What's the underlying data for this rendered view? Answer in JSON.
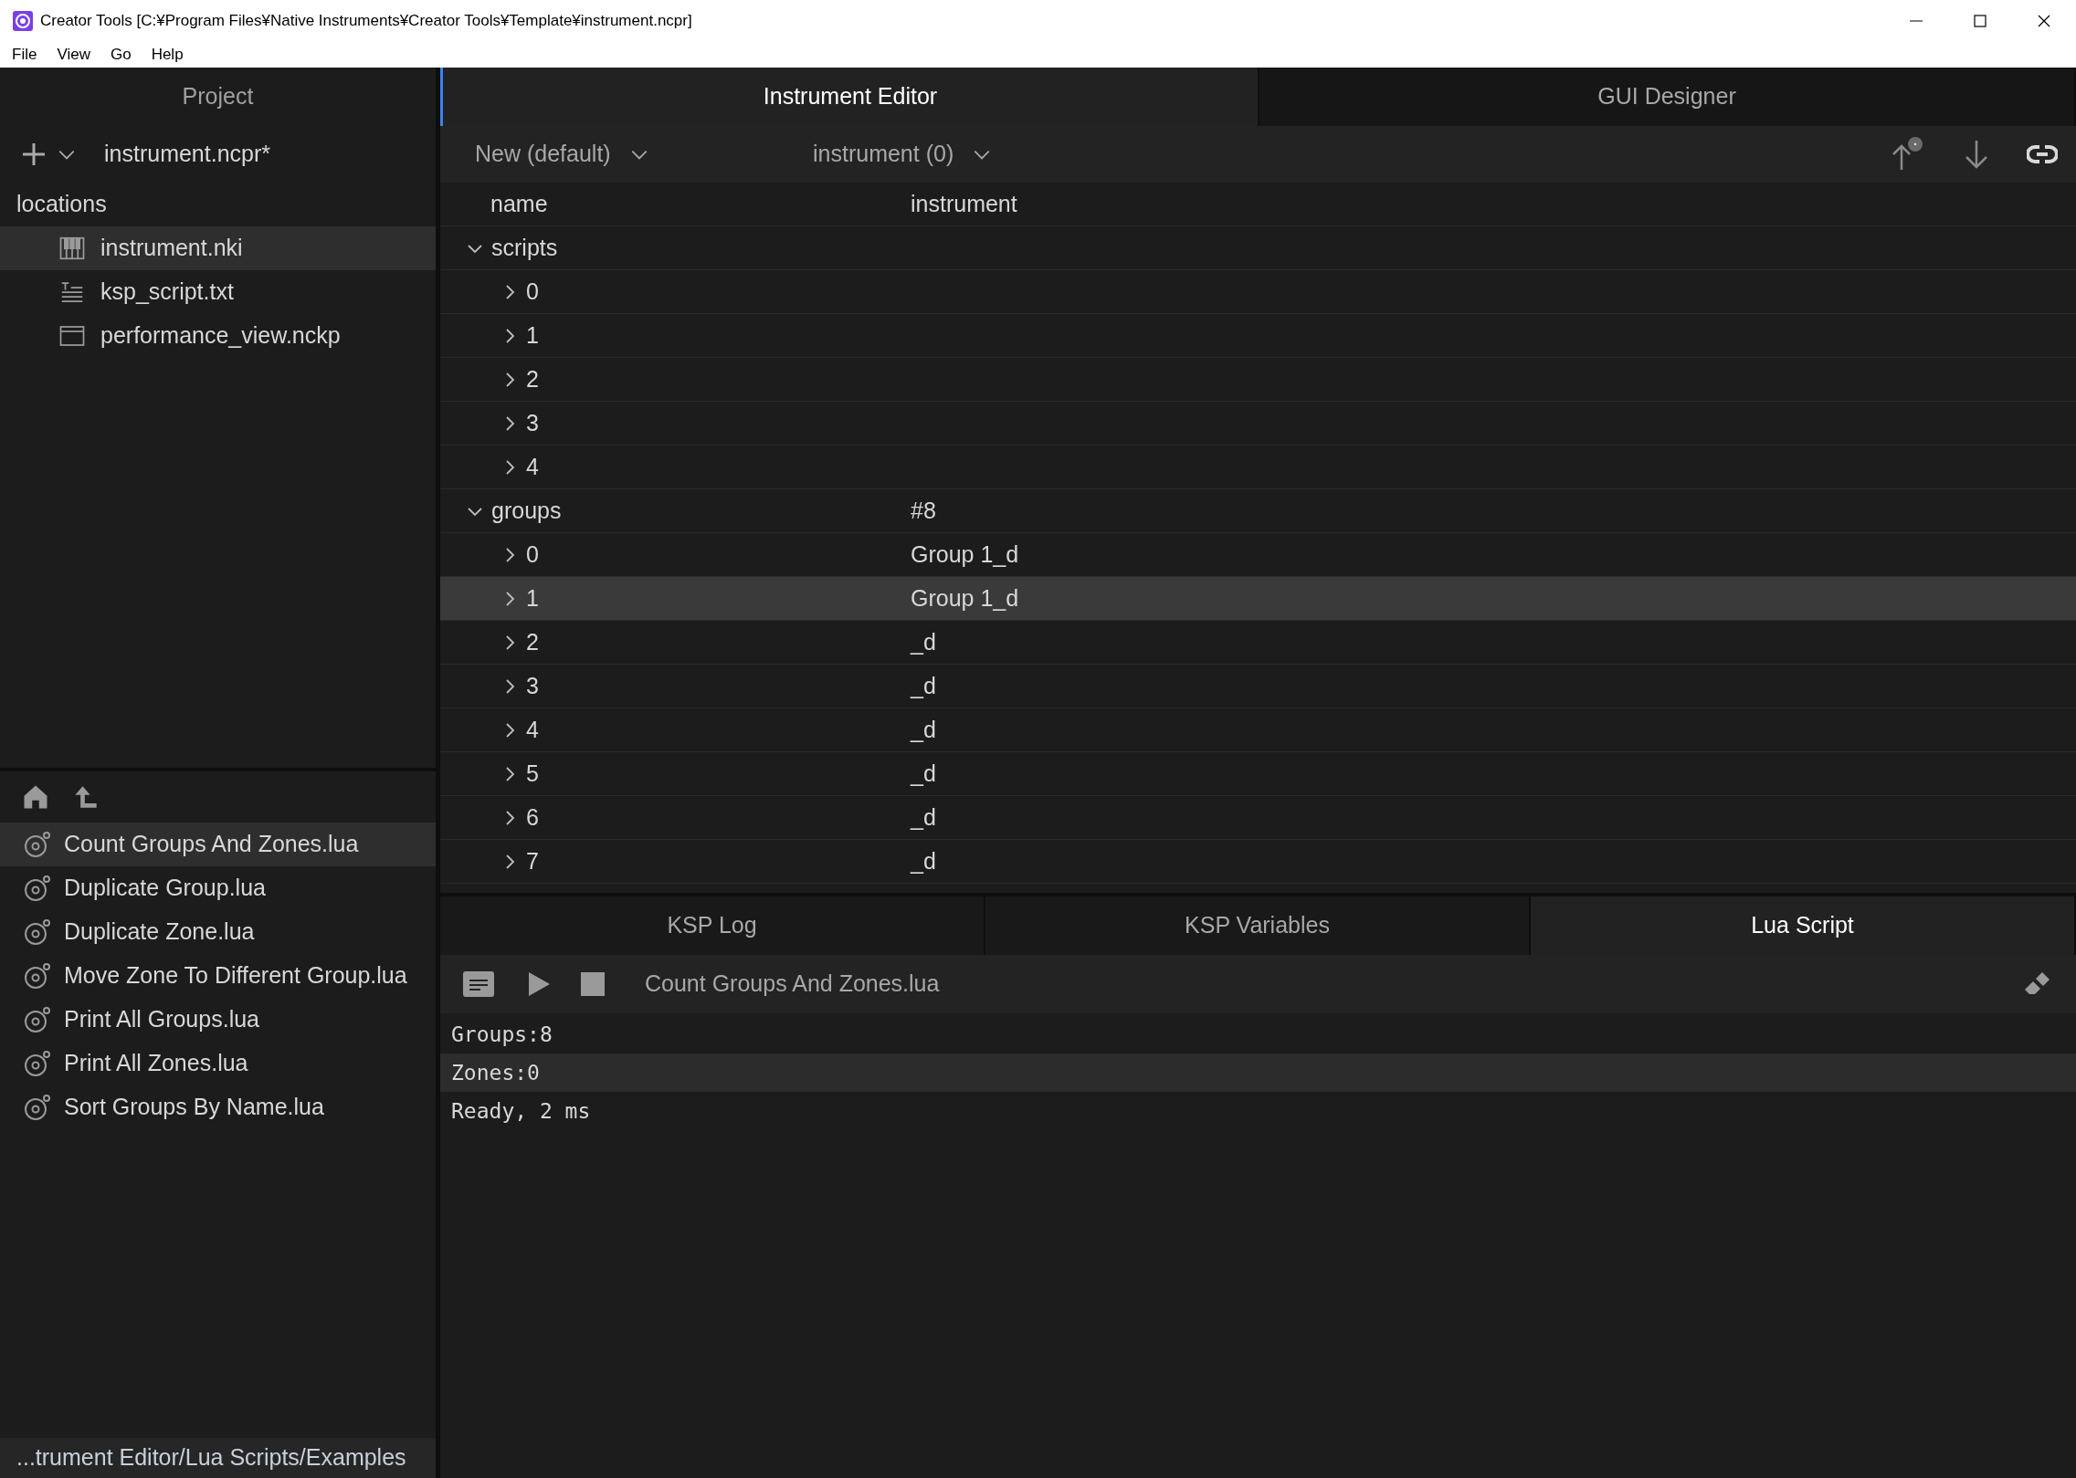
{
  "window": {
    "title": "Creator Tools [C:¥Program Files¥Native Instruments¥Creator Tools¥Template¥instrument.ncpr]"
  },
  "menu": [
    "File",
    "View",
    "Go",
    "Help"
  ],
  "project": {
    "header": "Project",
    "file": "instrument.ncpr*",
    "locations_label": "locations",
    "locations": [
      {
        "kind": "instrument",
        "label": "instrument.nki",
        "selected": true
      },
      {
        "kind": "script",
        "label": "ksp_script.txt",
        "selected": false
      },
      {
        "kind": "view",
        "label": "performance_view.nckp",
        "selected": false
      }
    ]
  },
  "scripts_browser": {
    "items": [
      {
        "label": "Count Groups And Zones.lua",
        "selected": true
      },
      {
        "label": "Duplicate Group.lua",
        "selected": false
      },
      {
        "label": "Duplicate Zone.lua",
        "selected": false
      },
      {
        "label": "Move Zone To Different Group.lua",
        "selected": false
      },
      {
        "label": "Print All Groups.lua",
        "selected": false
      },
      {
        "label": "Print All Zones.lua",
        "selected": false
      },
      {
        "label": "Sort Groups By Name.lua",
        "selected": false
      }
    ],
    "path": "...trument Editor/Lua Scripts/Examples"
  },
  "tabs": [
    {
      "label": "Instrument Editor",
      "selected": true
    },
    {
      "label": "GUI Designer",
      "selected": false
    }
  ],
  "toolbar": {
    "snapshot": "New (default)",
    "target": "instrument (0)"
  },
  "tree": {
    "columns": [
      "name",
      "instrument"
    ],
    "nodes": [
      {
        "label": "scripts",
        "expanded": true,
        "selected": false,
        "children": [
          {
            "label": "0",
            "expanded": false,
            "selected": false
          },
          {
            "label": "1",
            "expanded": false,
            "selected": false
          },
          {
            "label": "2",
            "expanded": false,
            "selected": false
          },
          {
            "label": "3",
            "expanded": false,
            "selected": false
          },
          {
            "label": "4",
            "expanded": false,
            "selected": false
          }
        ]
      },
      {
        "label": "groups",
        "value": "#8",
        "expanded": true,
        "selected": false,
        "children": [
          {
            "label": "0",
            "value": "Group 1_d",
            "expanded": false,
            "selected": false
          },
          {
            "label": "1",
            "value": "Group 1_d",
            "expanded": false,
            "selected": true
          },
          {
            "label": "2",
            "value": "_d",
            "expanded": false,
            "selected": false
          },
          {
            "label": "3",
            "value": "_d",
            "expanded": false,
            "selected": false
          },
          {
            "label": "4",
            "value": "_d",
            "expanded": false,
            "selected": false
          },
          {
            "label": "5",
            "value": "_d",
            "expanded": false,
            "selected": false
          },
          {
            "label": "6",
            "value": "_d",
            "expanded": false,
            "selected": false
          },
          {
            "label": "7",
            "value": "_d",
            "expanded": false,
            "selected": false
          }
        ]
      }
    ]
  },
  "bottom_tabs": [
    {
      "label": "KSP Log",
      "selected": false
    },
    {
      "label": "KSP Variables",
      "selected": false
    },
    {
      "label": "Lua Script",
      "selected": true
    }
  ],
  "lua": {
    "script_name": "Count Groups And Zones.lua",
    "output": [
      {
        "text": "Groups:8",
        "selected": false
      },
      {
        "text": "Zones:0",
        "selected": true
      },
      {
        "text": "Ready, 2 ms",
        "selected": false
      }
    ]
  }
}
